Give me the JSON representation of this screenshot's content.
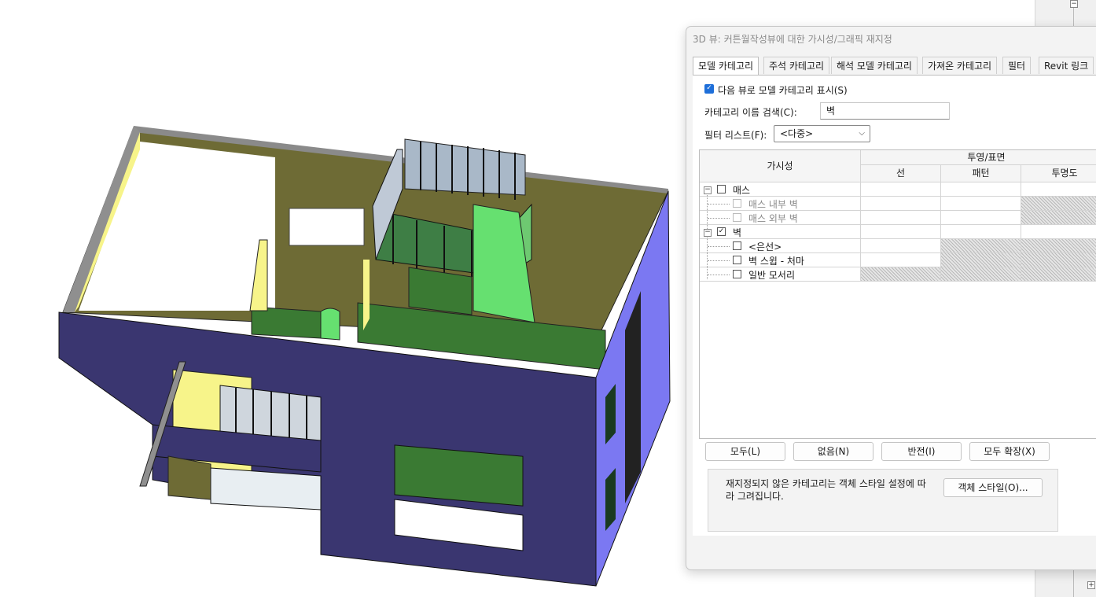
{
  "dialog": {
    "title": "3D 뷰: 커튼월작성뷰에 대한 가시성/그래픽 재지정",
    "tabs": [
      {
        "label": "모델 카테고리",
        "active": true
      },
      {
        "label": "주석 카테고리",
        "active": false
      },
      {
        "label": "해석 모델 카테고리",
        "active": false
      },
      {
        "label": "가져온 카테고리",
        "active": false
      },
      {
        "label": "필터",
        "active": false
      },
      {
        "label": "Revit 링크",
        "active": false
      }
    ],
    "show_model_categories": {
      "label": "다음 뷰로 모델 카테고리 표시(S)",
      "checked": true
    },
    "search": {
      "label": "카테고리 이름 검색(C):",
      "value": "벽"
    },
    "filter_list": {
      "label": "필터 리스트(F):",
      "value": "<다중>"
    },
    "grid": {
      "col_visibility": "가시성",
      "col_group": "투영/표면",
      "col_line": "선",
      "col_pattern": "패턴",
      "col_transparency": "투명도",
      "rows": [
        {
          "label": "매스",
          "checked": false,
          "dim": false
        },
        {
          "label": "매스 내부 벽",
          "checked": false,
          "dim": true
        },
        {
          "label": "매스 외부 벽",
          "checked": false,
          "dim": true
        },
        {
          "label": "벽",
          "checked": true,
          "dim": false
        },
        {
          "label": "<은선>",
          "checked": false,
          "dim": false
        },
        {
          "label": "벽 스윕 - 처마",
          "checked": false,
          "dim": false
        },
        {
          "label": "일반 모서리",
          "checked": false,
          "dim": false
        }
      ]
    },
    "buttons": {
      "all": "모두(L)",
      "none": "없음(N)",
      "invert": "반전(I)",
      "expand_all": "모두 확장(X)"
    },
    "note": "재지정되지 않은 카테고리는 객체 스타일 설정에 따라 그려집니다.",
    "object_styles_button": "객체 스타일(O)..."
  },
  "colors": {
    "exterior_wall": "#3a3670",
    "side_wall": "#7b78f2",
    "floor": "#6e6b35",
    "yellow_wall": "#f7f48a",
    "green_wall": "#3a7a33",
    "light_green": "#66e070",
    "checkbox_blue": "#1e6fd9"
  },
  "icons": {
    "checkmark": "✓",
    "tree_minus": "−",
    "tree_plus": "+",
    "dropdown": "⌵"
  }
}
